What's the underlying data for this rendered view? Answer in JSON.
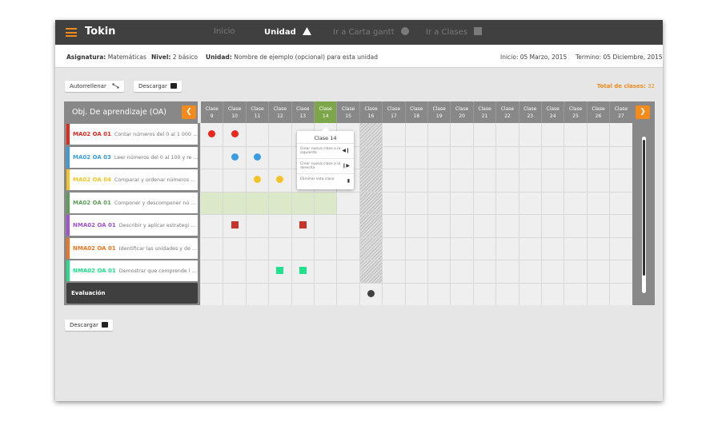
{
  "app": {
    "brand": "Tokin"
  },
  "nav": [
    {
      "label": "Inicio",
      "active": false
    },
    {
      "label": "Unidad",
      "active": true,
      "icon": "triangle-icon"
    },
    {
      "label": "Ir a Carta gantt",
      "active": false,
      "icon": "circle-icon"
    },
    {
      "label": "Ir a Clases",
      "active": false,
      "icon": "square-icon"
    }
  ],
  "info": {
    "asignatura_label": "Asignatura:",
    "asignatura": "Matemáticas",
    "nivel_label": "Nivel:",
    "nivel": "2 básico",
    "unidad_label": "Unidad:",
    "unidad": "Nombre de ejemplo (opcional) para esta unidad",
    "inicio": "Inicio: 05 Marzo, 2015",
    "termino": "Termino: 05 Diciembre, 2015"
  },
  "toolbar": {
    "autorrellenar": "Autorrellenar",
    "descargar": "Descargar",
    "total_label": "Total de clases:",
    "total_value": "32"
  },
  "oa_header": "Obj. De aprendizaje (OA)",
  "oa_rows": [
    {
      "code": "MA02 OA 01",
      "desc": "Contar números del 0 al 1 000 ...",
      "color": "#e8281c"
    },
    {
      "code": "MA02 OA 03",
      "desc": "Leer números del 0 al 100 y re ...",
      "color": "#3a9be5"
    },
    {
      "code": "MA02 OA 04",
      "desc": "Comparar y ordenar números ...",
      "color": "#f3c425"
    },
    {
      "code": "MA02 OA 01",
      "desc": "Componer y descomponer nú ...",
      "color": "#5e9e5a"
    },
    {
      "code": "NMA02 OA 01",
      "desc": "Describir y aplicar estrategi ...",
      "color": "#a34fd8"
    },
    {
      "code": "NMA02 OA 01",
      "desc": "Identificar las unidades y de ...",
      "color": "#f2731f"
    },
    {
      "code": "NMA02 OA 01",
      "desc": "Demostrar que comprende l ...",
      "color": "#1fe28a"
    }
  ],
  "evaluacion": "Evaluación",
  "class_label": "Clase",
  "classes": [
    "9",
    "10",
    "11",
    "12",
    "13",
    "14",
    "15",
    "16",
    "17",
    "18",
    "19",
    "20",
    "21",
    "22",
    "23",
    "24",
    "25",
    "26",
    "27"
  ],
  "selected_class": "14",
  "popup": {
    "title": "Clase 14",
    "items": [
      {
        "label": "Crear nueva clase a la izquierda",
        "icon": "insert-left-icon"
      },
      {
        "label": "Crear nueva clase a la derecha",
        "icon": "insert-right-icon"
      },
      {
        "label": "Eliminar esta clase",
        "icon": "trash-icon"
      }
    ]
  },
  "markers": [
    {
      "row": 0,
      "class": "9",
      "shape": "circle",
      "color": "#e8281c"
    },
    {
      "row": 0,
      "class": "10",
      "shape": "circle",
      "color": "#e8281c"
    },
    {
      "row": 1,
      "class": "10",
      "shape": "circle",
      "color": "#3a9be5"
    },
    {
      "row": 1,
      "class": "11",
      "shape": "circle",
      "color": "#3a9be5"
    },
    {
      "row": 2,
      "class": "11",
      "shape": "circle",
      "color": "#f3c425"
    },
    {
      "row": 2,
      "class": "12",
      "shape": "circle",
      "color": "#f3c425"
    },
    {
      "row": 4,
      "class": "10",
      "shape": "square",
      "color": "#c8342a"
    },
    {
      "row": 4,
      "class": "13",
      "shape": "square",
      "color": "#c8342a"
    },
    {
      "row": 6,
      "class": "12",
      "shape": "square",
      "color": "#1fe28a"
    },
    {
      "row": 6,
      "class": "13",
      "shape": "square",
      "color": "#1fe28a"
    },
    {
      "row": 7,
      "class": "16",
      "shape": "circle",
      "color": "#404040"
    }
  ],
  "footer": {
    "descargar": "Descargar"
  }
}
